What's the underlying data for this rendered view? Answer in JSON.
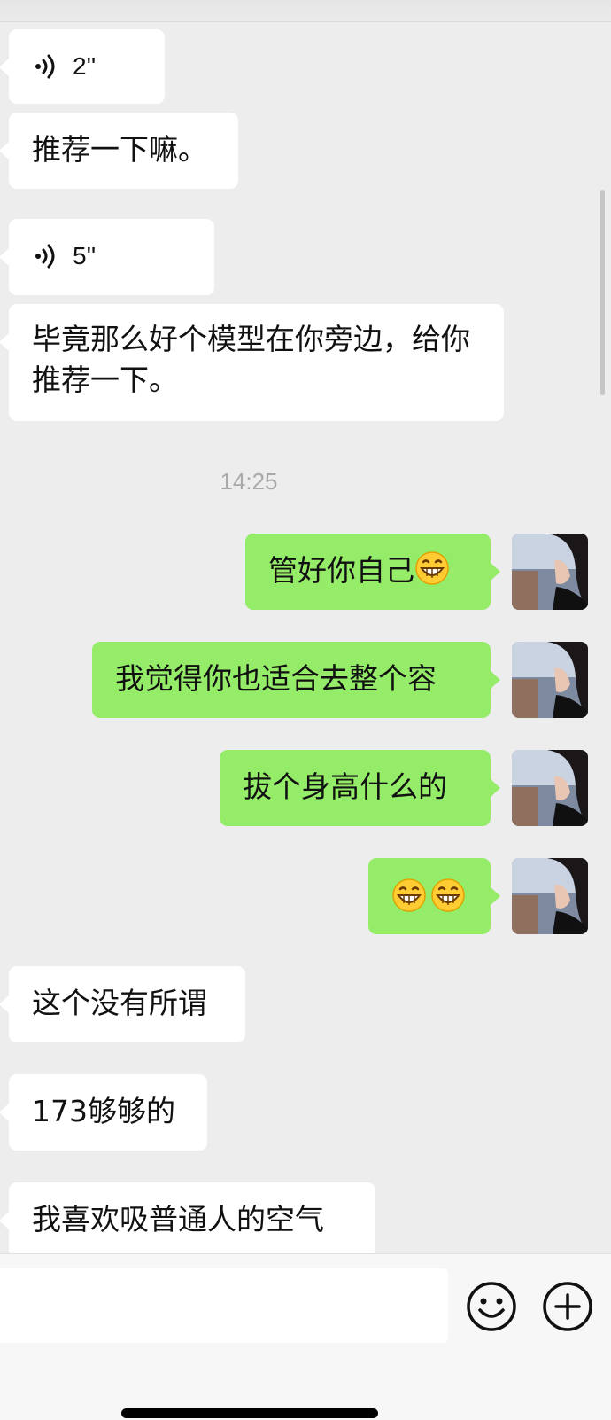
{
  "messages": [
    {
      "side": "in",
      "type": "voice",
      "duration": "2''"
    },
    {
      "side": "in",
      "type": "text",
      "text": "推荐一下嘛。"
    },
    {
      "side": "in",
      "type": "voice",
      "duration": "5''"
    },
    {
      "side": "in",
      "type": "text",
      "text": "毕竟那么好个模型在你旁边，给你推荐一下。"
    },
    {
      "side": "out",
      "type": "text",
      "text": "管好你自己",
      "emoji_suffix": "grin-emoji"
    },
    {
      "side": "out",
      "type": "text",
      "text": "我觉得你也适合去整个容"
    },
    {
      "side": "out",
      "type": "text",
      "text": "拔个身高什么的"
    },
    {
      "side": "out",
      "type": "emoji",
      "emoji": [
        "grin-emoji",
        "grin-emoji"
      ]
    },
    {
      "side": "in",
      "type": "text",
      "text": "这个没有所谓"
    },
    {
      "side": "in",
      "type": "text",
      "text": "173够够的"
    },
    {
      "side": "in",
      "type": "text",
      "text": "我喜欢吸普通人的空气"
    }
  ],
  "timestamp": "14:25",
  "input": {
    "value": "",
    "emoji_button_icon": "smiley-icon",
    "plus_button_icon": "plus-circle-icon"
  },
  "colors": {
    "background": "#ededed",
    "incoming_bubble": "#ffffff",
    "outgoing_bubble": "#95ec69",
    "timestamp_text": "#a9a9a9"
  }
}
